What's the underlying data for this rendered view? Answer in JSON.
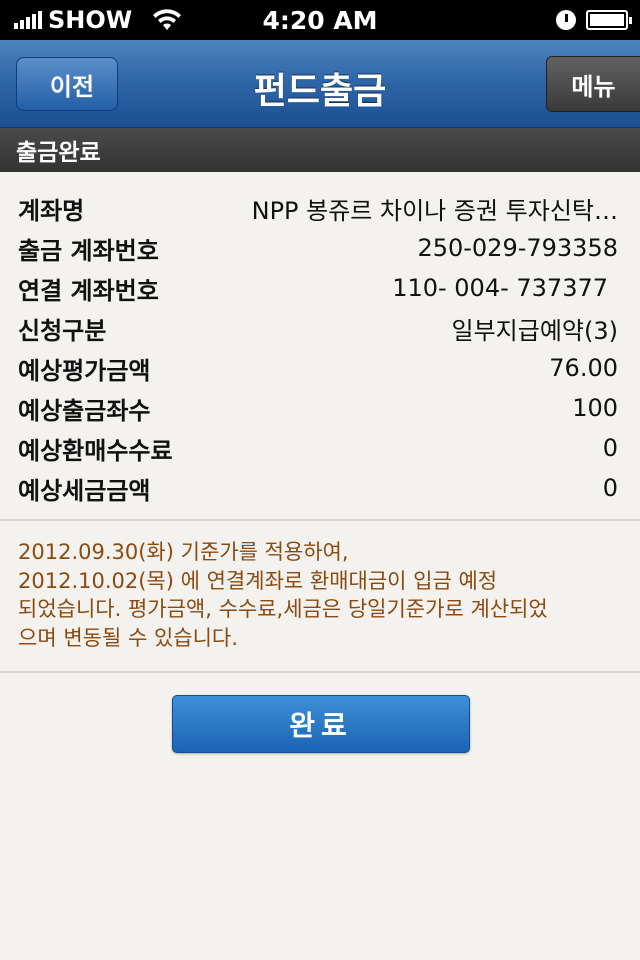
{
  "status_bar": {
    "carrier": "SHOW",
    "time": "4:20 AM"
  },
  "nav": {
    "back_label": "이전",
    "title": "펀드출금",
    "menu_label": "메뉴"
  },
  "section": {
    "title": "출금완료"
  },
  "details": [
    {
      "label": "계좌명",
      "value": "NPP 봉쥬르 차이나 증권 투자신탁…"
    },
    {
      "label": "출금 계좌번호",
      "value": "250-029-793358"
    },
    {
      "label": "연결 계좌번호",
      "value": "110- 004- 737377"
    },
    {
      "label": "신청구분",
      "value": "일부지급예약(3)"
    },
    {
      "label": "예상평가금액",
      "value": "76.00"
    },
    {
      "label": "예상출금좌수",
      "value": "100"
    },
    {
      "label": "예상환매수수료",
      "value": "0"
    },
    {
      "label": "예상세금금액",
      "value": "0"
    }
  ],
  "notice": {
    "line1": "2012.09.30(화) 기준가를 적용하여,",
    "line2": "2012.10.02(목) 에 연결계좌로 환매대금이 입금 예정",
    "line3": "되었습니다. 평가금액, 수수료,세금은 당일기준가로 계산되었",
    "line4": "으며 변동될 수 있습니다."
  },
  "confirm_label": "완료",
  "colors": {
    "nav_blue": "#2f67a8",
    "notice_text": "#8b4a10",
    "button_blue": "#1a64b4"
  }
}
